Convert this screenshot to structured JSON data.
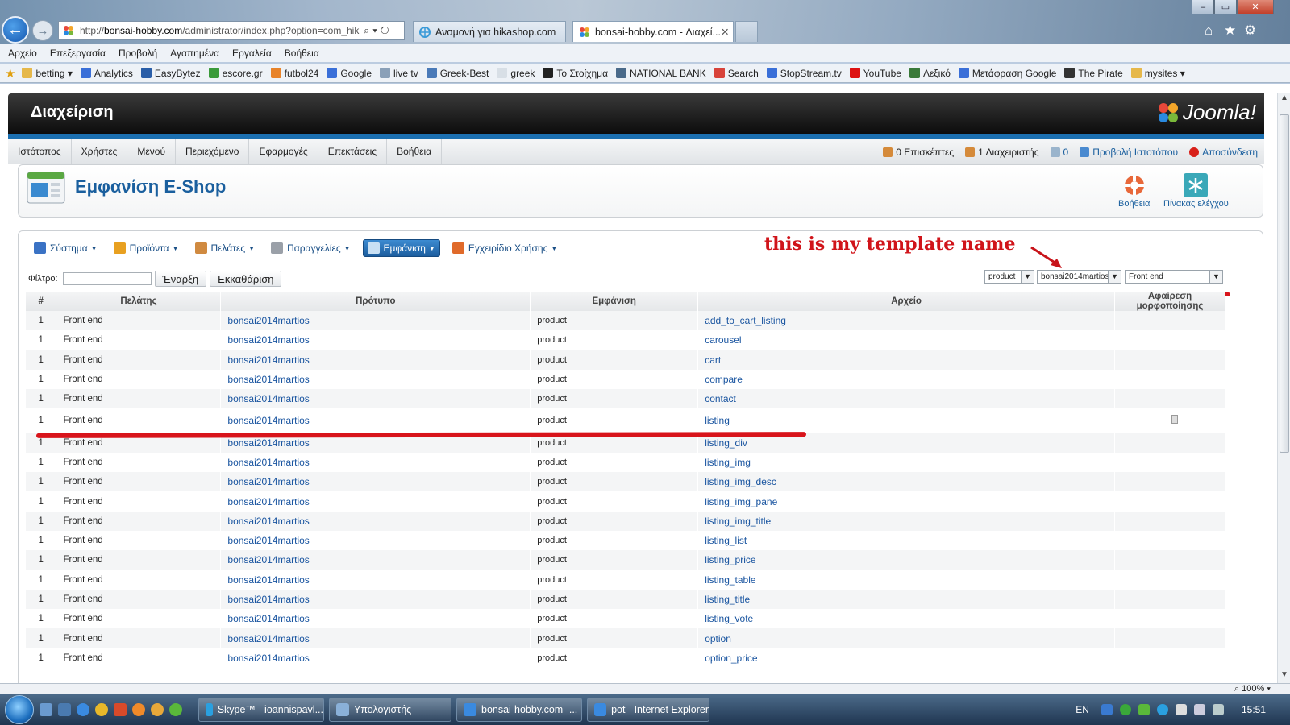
{
  "browser": {
    "url_prefix": "http://",
    "url_host": "bonsai-hobby.com",
    "url_path": "/administrator/index.php?option=com_hik",
    "tabs": [
      {
        "label": "Αναμονή για hikashop.com"
      },
      {
        "label": "bonsai-hobby.com - Διαχεί..."
      }
    ],
    "menu": [
      "Αρχείο",
      "Επεξεργασία",
      "Προβολή",
      "Αγαπημένα",
      "Εργαλεία",
      "Βοήθεια"
    ],
    "favorites": [
      {
        "label": "betting ▾",
        "color": "#e6b84a"
      },
      {
        "label": "Analytics",
        "color": "#3a6fd8"
      },
      {
        "label": "EasyBytez",
        "color": "#2a5ea8"
      },
      {
        "label": "escore.gr",
        "color": "#3a9a3a"
      },
      {
        "label": "futbol24",
        "color": "#e8832a"
      },
      {
        "label": "Google",
        "color": "#3a6fd8"
      },
      {
        "label": "live tv",
        "color": "#8aa0b8"
      },
      {
        "label": "Greek-Best",
        "color": "#4a7ab8"
      },
      {
        "label": "greek",
        "color": "#d8dfe6"
      },
      {
        "label": "Το Στοίχημα",
        "color": "#222"
      },
      {
        "label": "NATIONAL BANK",
        "color": "#4a6a8a"
      },
      {
        "label": "Search",
        "color": "#d8433a"
      },
      {
        "label": "StopStream.tv",
        "color": "#3a6fd8"
      },
      {
        "label": "YouTube",
        "color": "#d11"
      },
      {
        "label": "Λεξικό",
        "color": "#3a7a3a"
      },
      {
        "label": "Μετάφραση Google",
        "color": "#3a6fd8"
      },
      {
        "label": "The Pirate",
        "color": "#333"
      },
      {
        "label": "mysites ▾",
        "color": "#e6b84a"
      }
    ],
    "zoom": "100%"
  },
  "admin": {
    "header_title": "Διαχείριση",
    "logo_text": "Joomla!",
    "menu": [
      "Ιστότοπος",
      "Χρήστες",
      "Μενού",
      "Περιεχόμενο",
      "Εφαρμογές",
      "Επεκτάσεις",
      "Βοήθεια"
    ],
    "status": {
      "visitors": "0 Επισκέπτες",
      "admins": "1 Διαχειριστής",
      "messages": "0",
      "preview": "Προβολή Ιστοτόπου",
      "logout": "Αποσύνδεση"
    }
  },
  "page": {
    "title": "Εμφανίση E-Shop",
    "toolbar": {
      "help": "Βοήθεια",
      "control_panel": "Πίνακας ελέγχου"
    },
    "submenu": [
      {
        "label": "Σύστημα",
        "color": "#3a72c4"
      },
      {
        "label": "Προϊόντα",
        "color": "#e8a020"
      },
      {
        "label": "Πελάτες",
        "color": "#d08a40"
      },
      {
        "label": "Παραγγελίες",
        "color": "#9aa0a8"
      },
      {
        "label": "Εμφάνιση",
        "color": "#c8e0f4"
      },
      {
        "label": "Εγχειρίδιο Χρήσης",
        "color": "#e06a2a"
      }
    ],
    "filter": {
      "label": "Φίλτρο:",
      "value": "",
      "go": "Έναρξη",
      "reset": "Εκκαθάριση"
    },
    "selects": {
      "view_type": "product",
      "template": "bonsai2014martios",
      "client": "Front end"
    },
    "annotation": "this is my template name",
    "table": {
      "headers": [
        "#",
        "Πελάτης",
        "Πρότυπο",
        "Εμφάνιση",
        "Αρχείο",
        "Αφαίρεση μορφοποίησης"
      ],
      "rows": [
        {
          "num": "1",
          "client": "Front end",
          "template": "bonsai2014martios",
          "view": "product",
          "file": "add_to_cart_listing"
        },
        {
          "num": "1",
          "client": "Front end",
          "template": "bonsai2014martios",
          "view": "product",
          "file": "carousel"
        },
        {
          "num": "1",
          "client": "Front end",
          "template": "bonsai2014martios",
          "view": "product",
          "file": "cart"
        },
        {
          "num": "1",
          "client": "Front end",
          "template": "bonsai2014martios",
          "view": "product",
          "file": "compare"
        },
        {
          "num": "1",
          "client": "Front end",
          "template": "bonsai2014martios",
          "view": "product",
          "file": "contact"
        },
        {
          "num": "1",
          "client": "Front end",
          "template": "bonsai2014martios",
          "view": "product",
          "file": "listing",
          "has_trash": true
        },
        {
          "num": "1",
          "client": "Front end",
          "template": "bonsai2014martios",
          "view": "product",
          "file": "listing_div"
        },
        {
          "num": "1",
          "client": "Front end",
          "template": "bonsai2014martios",
          "view": "product",
          "file": "listing_img"
        },
        {
          "num": "1",
          "client": "Front end",
          "template": "bonsai2014martios",
          "view": "product",
          "file": "listing_img_desc"
        },
        {
          "num": "1",
          "client": "Front end",
          "template": "bonsai2014martios",
          "view": "product",
          "file": "listing_img_pane"
        },
        {
          "num": "1",
          "client": "Front end",
          "template": "bonsai2014martios",
          "view": "product",
          "file": "listing_img_title"
        },
        {
          "num": "1",
          "client": "Front end",
          "template": "bonsai2014martios",
          "view": "product",
          "file": "listing_list"
        },
        {
          "num": "1",
          "client": "Front end",
          "template": "bonsai2014martios",
          "view": "product",
          "file": "listing_price"
        },
        {
          "num": "1",
          "client": "Front end",
          "template": "bonsai2014martios",
          "view": "product",
          "file": "listing_table"
        },
        {
          "num": "1",
          "client": "Front end",
          "template": "bonsai2014martios",
          "view": "product",
          "file": "listing_title"
        },
        {
          "num": "1",
          "client": "Front end",
          "template": "bonsai2014martios",
          "view": "product",
          "file": "listing_vote"
        },
        {
          "num": "1",
          "client": "Front end",
          "template": "bonsai2014martios",
          "view": "product",
          "file": "option"
        },
        {
          "num": "1",
          "client": "Front end",
          "template": "bonsai2014martios",
          "view": "product",
          "file": "option_price"
        }
      ]
    }
  },
  "taskbar": {
    "tasks": [
      {
        "label": "Skype™ - ioannispavl...",
        "color": "#2aa0e0"
      },
      {
        "label": "Υπολογιστής",
        "color": "#8ab0d8"
      },
      {
        "label": "bonsai-hobby.com -...",
        "color": "#3a8ae0"
      },
      {
        "label": "pot - Internet Explorer",
        "color": "#3a8ae0"
      }
    ],
    "lang": "EN",
    "time": "15:51"
  }
}
